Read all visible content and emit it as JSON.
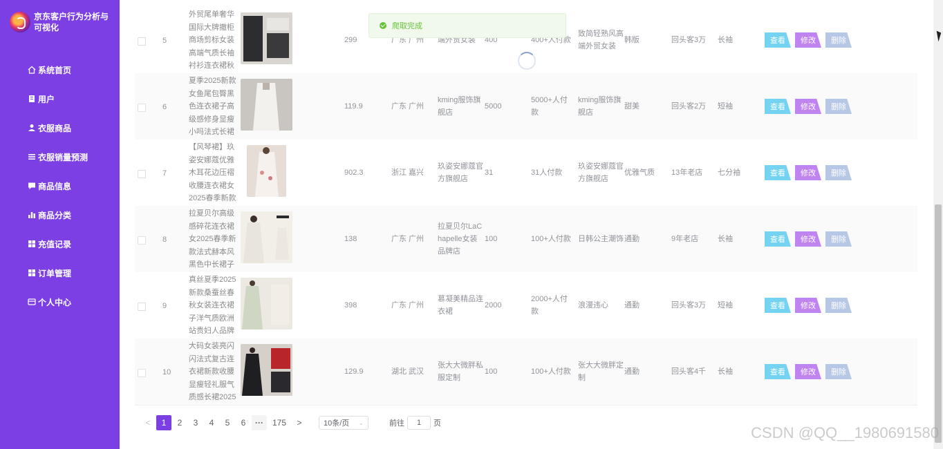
{
  "app": {
    "title": "京东客户行为分析与可视化"
  },
  "sidebar": {
    "items": [
      {
        "label": "系统首页",
        "icon": "home-icon"
      },
      {
        "label": "用户",
        "icon": "user-card-icon"
      },
      {
        "label": "衣服商品",
        "icon": "person-icon"
      },
      {
        "label": "衣服销量预测",
        "icon": "list-icon"
      },
      {
        "label": "商品信息",
        "icon": "message-icon"
      },
      {
        "label": "商品分类",
        "icon": "bar-chart-icon"
      },
      {
        "label": "充值记录",
        "icon": "grid-icon"
      },
      {
        "label": "订单管理",
        "icon": "grid-icon"
      },
      {
        "label": "个人中心",
        "icon": "profile-icon"
      }
    ]
  },
  "toast": {
    "message": "爬取完成",
    "type": "success"
  },
  "table": {
    "actions": {
      "view": "查看",
      "edit": "修改",
      "delete": "删除"
    },
    "rows": [
      {
        "index": "5",
        "name": "外贸尾单奢华国际大牌撤柜商场剪标女装高端气质长袖衬衫连衣裙秋",
        "price": "299",
        "location": "广东 广州",
        "shop": "端外贸女装",
        "sales": "400",
        "pay": "400+人付款",
        "brand": "致简轻熟风高端外贸女装",
        "style": "韩版",
        "repurchase": "回头客3万",
        "sleeve": "长袖"
      },
      {
        "index": "6",
        "name": "夏季2025新款女鱼尾包臀黑色连衣裙子高级感修身显瘦小吗法式长裙",
        "price": "119.9",
        "location": "广东 广州",
        "shop": "kming服饰旗舰店",
        "sales": "5000",
        "pay": "5000+人付款",
        "brand": "kming服饰旗舰店",
        "style": "甜美",
        "repurchase": "回头客2万",
        "sleeve": "短袖"
      },
      {
        "index": "7",
        "name": "【风琴裙】玖姿安娜蔻优雅木耳花边压褶收腰连衣裙女2025春季新款",
        "price": "902.3",
        "location": "浙江 嘉兴",
        "shop": "玖姿安娜蔻官方旗舰店",
        "sales": "31",
        "pay": "31人付款",
        "brand": "玖姿安娜蔻官方旗舰店",
        "style": "优雅气质",
        "repurchase": "13年老店",
        "sleeve": "七分袖"
      },
      {
        "index": "8",
        "name": "拉夏贝尔高级感碎花连衣裙女2025春季新款法式赫本风黑色中长裙子",
        "price": "138",
        "location": "广东 广州",
        "shop": "拉夏贝尔LaChapelle女装品牌店",
        "sales": "100",
        "pay": "100+人付款",
        "brand": "日韩公主潮饰",
        "style": "通勤",
        "repurchase": "9年老店",
        "sleeve": "长袖"
      },
      {
        "index": "9",
        "name": "真丝夏季2025新款桑蚕丝春秋女装连衣裙子洋气质欧洲站贵妇人品牌",
        "price": "398",
        "location": "广东 广州",
        "shop": "慕凝美精品连衣裙",
        "sales": "2000",
        "pay": "2000+人付款",
        "brand": "浪漫违心",
        "style": "通勤",
        "repurchase": "回头客3万",
        "sleeve": "短袖"
      },
      {
        "index": "10",
        "name": "大码女装亮闪闪法式复古连衣裙新款收腰显瘦轻礼服气质感长裙2025",
        "price": "129.9",
        "location": "湖北 武汉",
        "shop": "张大大微胖私服定制",
        "sales": "100",
        "pay": "100+人付款",
        "brand": "张大大微胖定制",
        "style": "通勤",
        "repurchase": "回头客4千",
        "sleeve": "长袖"
      }
    ]
  },
  "pagination": {
    "prev": "<",
    "next": ">",
    "pages": [
      "1",
      "2",
      "3",
      "4",
      "5",
      "6"
    ],
    "current": "1",
    "ellipsis": "···",
    "last": "175",
    "page_size": "10条/页",
    "goto_label": "前往",
    "goto_value": "1",
    "goto_suffix": "页"
  },
  "watermark": "CSDN @QQ__1980691580",
  "colors": {
    "sidebar": "#7b3fe4",
    "view": "#74d3f0",
    "edit": "#c084f0",
    "delete": "#b7c8e6",
    "success": "#67c23a"
  }
}
